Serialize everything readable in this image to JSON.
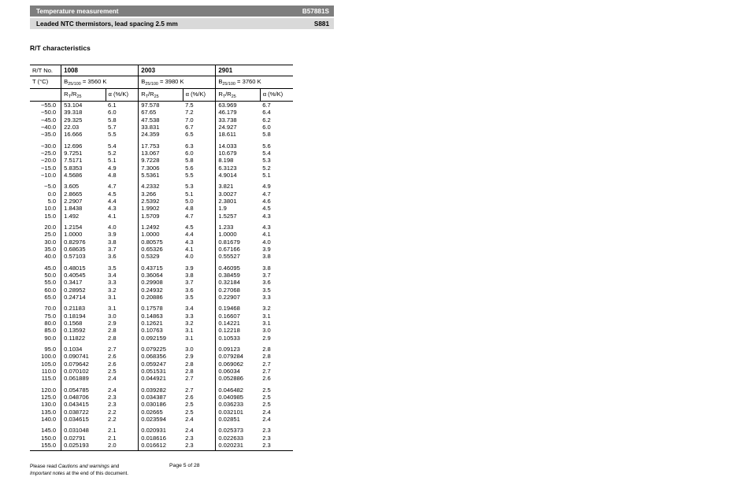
{
  "header": {
    "title": "Temperature measurement",
    "part_number": "B57881S",
    "subtitle": "Leaded NTC thermistors, lead spacing 2.5 mm",
    "series": "S881",
    "dark_bar_color": "#7e7e7e",
    "light_bar_color": "#d9d9d9"
  },
  "section_title": "R/T characteristics",
  "table": {
    "corner_label": "R/T No.",
    "temp_label": "T (°C)",
    "groups": [
      {
        "no": "1008",
        "b_label": "B",
        "b_sub": "25/100",
        "b_value": "= 3560 K"
      },
      {
        "no": "2003",
        "b_label": "B",
        "b_sub": "25/100",
        "b_value": "= 3980 K"
      },
      {
        "no": "2901",
        "b_label": "B",
        "b_sub": "25/100",
        "b_value": "= 3760 K"
      }
    ],
    "sub_headers": {
      "ratio_num": "R",
      "ratio_num_sub": "T",
      "ratio_den": "/R",
      "ratio_den_sub": "25",
      "alpha": "α (%/K)"
    }
  },
  "chart_data": {
    "type": "table",
    "title": "R/T characteristics",
    "columns": [
      "T (°C)",
      "1008 RT/R25",
      "1008 α (%/K)",
      "2003 RT/R25",
      "2003 α (%/K)",
      "2901 RT/R25",
      "2901 α (%/K)"
    ],
    "blocks": [
      [
        [
          "−55.0",
          "53.104",
          "6.1",
          "97.578",
          "7.5",
          "63.969",
          "6.7"
        ],
        [
          "−50.0",
          "39.318",
          "6.0",
          "67.65",
          "7.2",
          "46.179",
          "6.4"
        ],
        [
          "−45.0",
          "29.325",
          "5.8",
          "47.538",
          "7.0",
          "33.738",
          "6.2"
        ],
        [
          "−40.0",
          "22.03",
          "5.7",
          "33.831",
          "6.7",
          "24.927",
          "6.0"
        ],
        [
          "−35.0",
          "16.666",
          "5.5",
          "24.359",
          "6.5",
          "18.611",
          "5.8"
        ]
      ],
      [
        [
          "−30.0",
          "12.696",
          "5.4",
          "17.753",
          "6.3",
          "14.033",
          "5.6"
        ],
        [
          "−25.0",
          "9.7251",
          "5.2",
          "13.067",
          "6.0",
          "10.679",
          "5.4"
        ],
        [
          "−20.0",
          "7.5171",
          "5.1",
          "9.7228",
          "5.8",
          "8.198",
          "5.3"
        ],
        [
          "−15.0",
          "5.8353",
          "4.9",
          "7.3006",
          "5.6",
          "6.3123",
          "5.2"
        ],
        [
          "−10.0",
          "4.5686",
          "4.8",
          "5.5361",
          "5.5",
          "4.9014",
          "5.1"
        ]
      ],
      [
        [
          "−5.0",
          "3.605",
          "4.7",
          "4.2332",
          "5.3",
          "3.821",
          "4.9"
        ],
        [
          "0.0",
          "2.8665",
          "4.5",
          "3.266",
          "5.1",
          "3.0027",
          "4.7"
        ],
        [
          "5.0",
          "2.2907",
          "4.4",
          "2.5392",
          "5.0",
          "2.3801",
          "4.6"
        ],
        [
          "10.0",
          "1.8438",
          "4.3",
          "1.9902",
          "4.8",
          "1.9",
          "4.5"
        ],
        [
          "15.0",
          "1.492",
          "4.1",
          "1.5709",
          "4.7",
          "1.5257",
          "4.3"
        ]
      ],
      [
        [
          "20.0",
          "1.2154",
          "4.0",
          "1.2492",
          "4.5",
          "1.233",
          "4.3"
        ],
        [
          "25.0",
          "1.0000",
          "3.9",
          "1.0000",
          "4.4",
          "1.0000",
          "4.1"
        ],
        [
          "30.0",
          "0.82976",
          "3.8",
          "0.80575",
          "4.3",
          "0.81679",
          "4.0"
        ],
        [
          "35.0",
          "0.68635",
          "3.7",
          "0.65326",
          "4.1",
          "0.67166",
          "3.9"
        ],
        [
          "40.0",
          "0.57103",
          "3.6",
          "0.5329",
          "4.0",
          "0.55527",
          "3.8"
        ]
      ],
      [
        [
          "45.0",
          "0.48015",
          "3.5",
          "0.43715",
          "3.9",
          "0.46095",
          "3.8"
        ],
        [
          "50.0",
          "0.40545",
          "3.4",
          "0.36064",
          "3.8",
          "0.38459",
          "3.7"
        ],
        [
          "55.0",
          "0.3417",
          "3.3",
          "0.29908",
          "3.7",
          "0.32184",
          "3.6"
        ],
        [
          "60.0",
          "0.28952",
          "3.2",
          "0.24932",
          "3.6",
          "0.27068",
          "3.5"
        ],
        [
          "65.0",
          "0.24714",
          "3.1",
          "0.20886",
          "3.5",
          "0.22907",
          "3.3"
        ]
      ],
      [
        [
          "70.0",
          "0.21183",
          "3.1",
          "0.17578",
          "3.4",
          "0.19468",
          "3.2"
        ],
        [
          "75.0",
          "0.18194",
          "3.0",
          "0.14863",
          "3.3",
          "0.16607",
          "3.1"
        ],
        [
          "80.0",
          "0.1568",
          "2.9",
          "0.12621",
          "3.2",
          "0.14221",
          "3.1"
        ],
        [
          "85.0",
          "0.13592",
          "2.8",
          "0.10763",
          "3.1",
          "0.12218",
          "3.0"
        ],
        [
          "90.0",
          "0.11822",
          "2.8",
          "0.092159",
          "3.1",
          "0.10533",
          "2.9"
        ]
      ],
      [
        [
          "95.0",
          "0.1034",
          "2.7",
          "0.079225",
          "3.0",
          "0.09123",
          "2.8"
        ],
        [
          "100.0",
          "0.090741",
          "2.6",
          "0.068356",
          "2.9",
          "0.079284",
          "2.8"
        ],
        [
          "105.0",
          "0.079642",
          "2.6",
          "0.059247",
          "2.8",
          "0.069062",
          "2.7"
        ],
        [
          "110.0",
          "0.070102",
          "2.5",
          "0.051531",
          "2.8",
          "0.06034",
          "2.7"
        ],
        [
          "115.0",
          "0.061889",
          "2.4",
          "0.044921",
          "2.7",
          "0.052886",
          "2.6"
        ]
      ],
      [
        [
          "120.0",
          "0.054785",
          "2.4",
          "0.039282",
          "2.7",
          "0.046482",
          "2.5"
        ],
        [
          "125.0",
          "0.048706",
          "2.3",
          "0.034387",
          "2.6",
          "0.040985",
          "2.5"
        ],
        [
          "130.0",
          "0.043415",
          "2.3",
          "0.030186",
          "2.5",
          "0.036233",
          "2.5"
        ],
        [
          "135.0",
          "0.038722",
          "2.2",
          "0.02665",
          "2.5",
          "0.032101",
          "2.4"
        ],
        [
          "140.0",
          "0.034615",
          "2.2",
          "0.023594",
          "2.4",
          "0.02851",
          "2.4"
        ]
      ],
      [
        [
          "145.0",
          "0.031048",
          "2.1",
          "0.020931",
          "2.4",
          "0.025373",
          "2.3"
        ],
        [
          "150.0",
          "0.02791",
          "2.1",
          "0.018616",
          "2.3",
          "0.022633",
          "2.3"
        ],
        [
          "155.0",
          "0.025193",
          "2.0",
          "0.016612",
          "2.3",
          "0.020231",
          "2.3"
        ]
      ]
    ]
  },
  "footer": {
    "line1_pre": "Please read ",
    "line1_italic": "Cautions and warnings",
    "line1_post": " and",
    "line2_italic": "Important notes",
    "line2_post": " at the end of this document.",
    "page": "Page 5 of 28"
  }
}
